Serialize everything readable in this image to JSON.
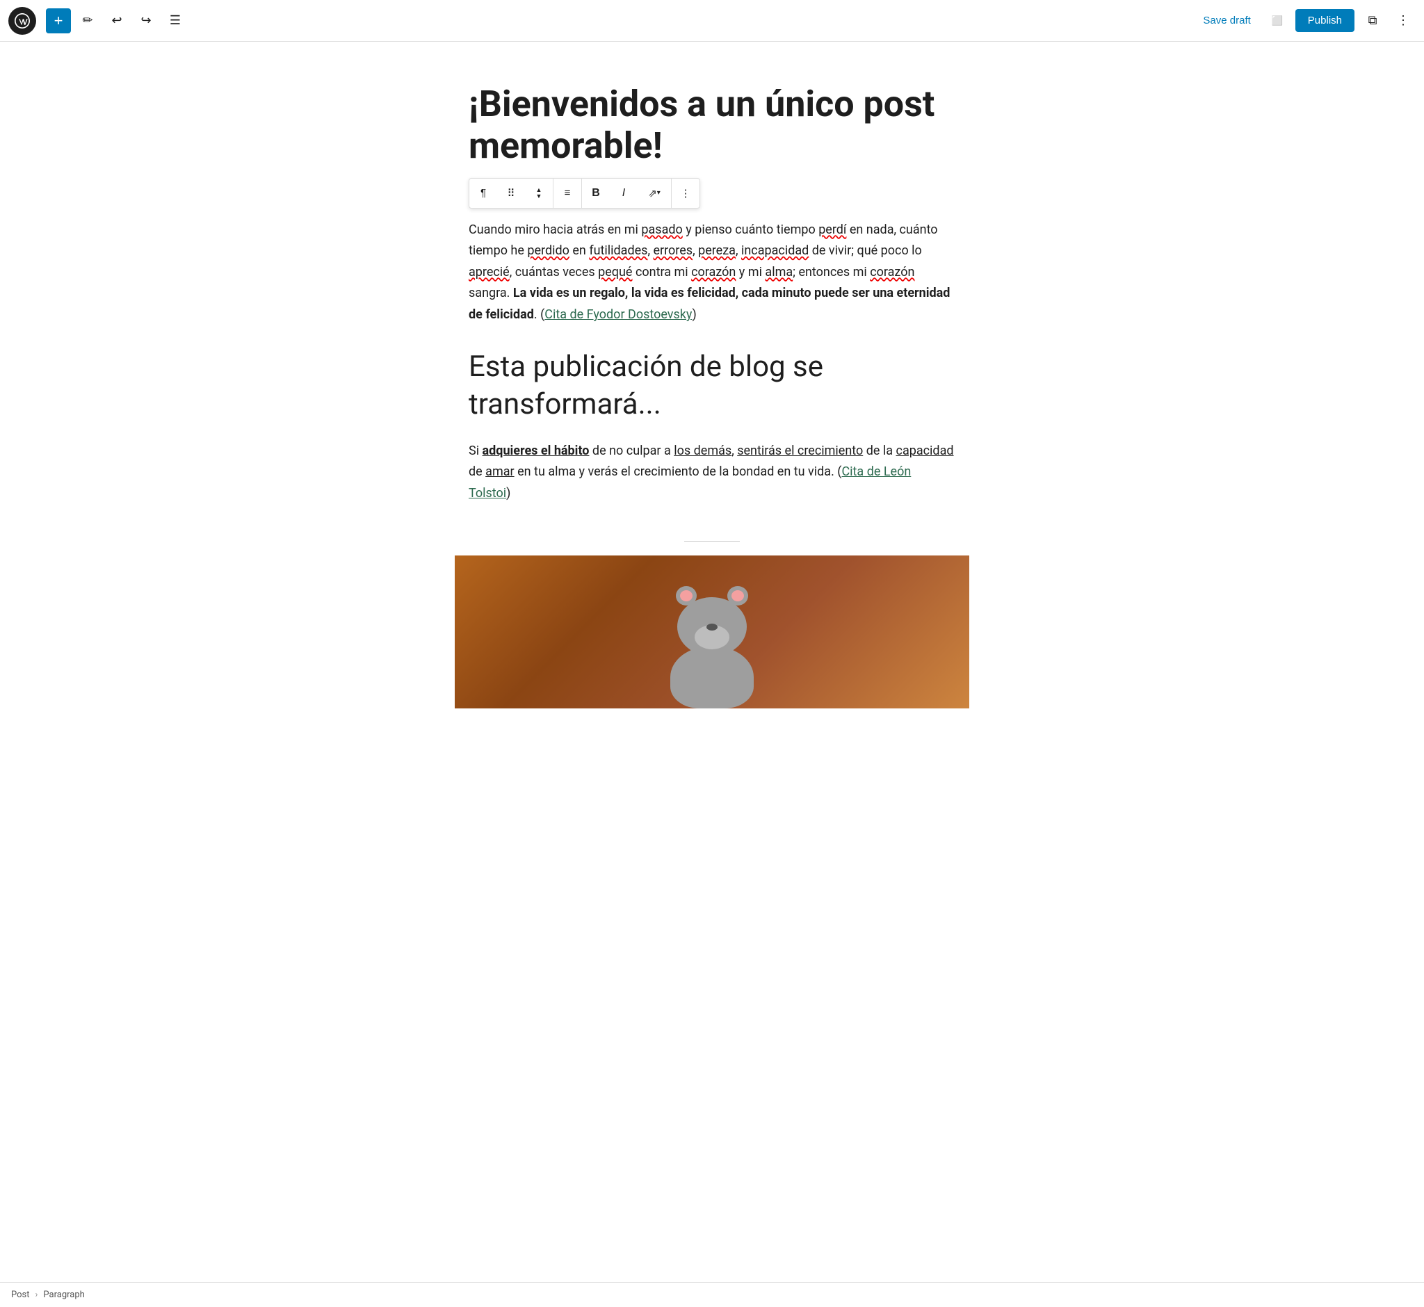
{
  "toolbar": {
    "add_label": "+",
    "save_draft_label": "Save draft",
    "publish_label": "Publish"
  },
  "inline_toolbar": {
    "paragraph_symbol": "¶",
    "drag_symbol": "⠿",
    "align_symbol": "≡",
    "bold_label": "B",
    "italic_label": "I",
    "link_symbol": "⇗",
    "dropdown_symbol": "∨",
    "more_symbol": "⋮"
  },
  "content": {
    "title": "¡Bienvenidos a un único post memorable!",
    "paragraph1": "Cuando miro hacia atrás en mi pasado y pienso cuánto tiempo perdí en nada, cuánto tiempo he perdido en futilidades, errores, pereza, incapacidad de vivir; qué poco lo aprecié, cuántas veces pequé contra mi corazón y mi alma; entonces mi corazón sangra. ",
    "paragraph1_bold": "La vida es un regalo, la vida es felicidad, cada minuto puede ser una eternidad de felicidad",
    "paragraph1_suffix": ". (",
    "paragraph1_link": "Cita de Fyodor Dostoevsky",
    "paragraph1_end": ")",
    "heading2": "Esta publicación de blog se transformará...",
    "paragraph2_start": "Si ",
    "paragraph2_bold1": "adquieres el hábito",
    "paragraph2_mid1": " de no culpar a ",
    "paragraph2_under1": "los demás",
    "paragraph2_mid2": ", ",
    "paragraph2_under2": "sentirás el crecimiento",
    "paragraph2_mid3": " de la ",
    "paragraph2_under3": "capacidad",
    "paragraph2_mid4": " de ",
    "paragraph2_under4": "amar",
    "paragraph2_mid5": " en tu alma y verás el crecimiento de la bondad en tu vida.",
    "paragraph2_suffix": " (",
    "paragraph2_link": "Cita de León Tolstoi",
    "paragraph2_end": ")",
    "status_breadcrumb": [
      "Post",
      "Paragraph"
    ]
  },
  "colors": {
    "accent": "#007cba",
    "link": "#2d6a4f",
    "spell_underline": "#e00000",
    "toolbar_bg": "#ffffff",
    "border": "#dddddd"
  }
}
